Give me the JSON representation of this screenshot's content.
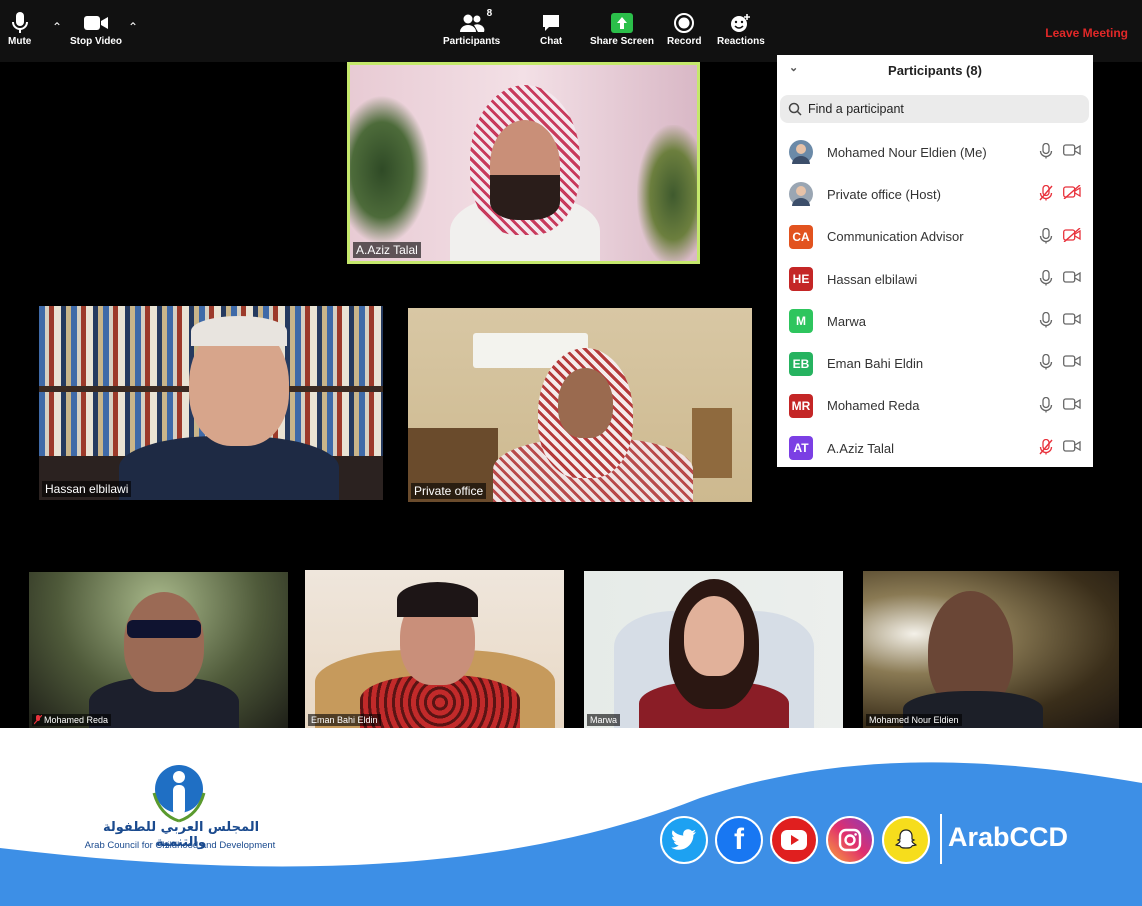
{
  "toolbar": {
    "mute": "Mute",
    "stop_video": "Stop Video",
    "participants": "Participants",
    "participants_count": "8",
    "chat": "Chat",
    "share_screen": "Share Screen",
    "record": "Record",
    "reactions": "Reactions",
    "leave": "Leave Meeting"
  },
  "tiles": {
    "active": "A.Aziz Talal",
    "hassan": "Hassan elbilawi",
    "private": "Private office",
    "mohamed_reda": "Mohamed Reda",
    "eman": "Eman Bahi Eldin",
    "marwa": "Marwa",
    "nour": "Mohamed Nour Eldien"
  },
  "panel": {
    "title": "Participants (8)",
    "search_placeholder": "Find a participant",
    "participants": [
      {
        "name": "Mohamed Nour Eldien (Me)",
        "avatar": "",
        "color": "#6b8aa8",
        "mic_muted": false,
        "video_off": false
      },
      {
        "name": "Private office (Host)",
        "avatar": "",
        "color": "#9aa6b3",
        "mic_muted": true,
        "video_off": true
      },
      {
        "name": "Communication Advisor",
        "avatar": "CA",
        "color": "#e2531f",
        "mic_muted": false,
        "video_off": true
      },
      {
        "name": "Hassan elbilawi",
        "avatar": "HE",
        "color": "#c42626",
        "mic_muted": false,
        "video_off": false
      },
      {
        "name": "Marwa",
        "avatar": "M",
        "color": "#2ec55e",
        "mic_muted": false,
        "video_off": false
      },
      {
        "name": "Eman Bahi Eldin",
        "avatar": "EB",
        "color": "#26b360",
        "mic_muted": false,
        "video_off": false
      },
      {
        "name": "Mohamed Reda",
        "avatar": "MR",
        "color": "#c42626",
        "mic_muted": false,
        "video_off": false
      },
      {
        "name": "A.Aziz Talal",
        "avatar": "AT",
        "color": "#7b3fe4",
        "mic_muted": true,
        "video_off": false
      }
    ]
  },
  "footer": {
    "org_arabic": "المجلس العربي للطفولة والتنمية",
    "org_english": "Arab Council for Childhood and Development",
    "handle": "ArabCCD",
    "social": [
      "twitter-icon",
      "facebook-icon",
      "youtube-icon",
      "instagram-icon",
      "snapchat-icon"
    ]
  },
  "colors": {
    "accent_blue": "#3d8fe6",
    "leave_red": "#e02828",
    "active_border": "#c5e86c",
    "muted_red": "#e8323c"
  }
}
